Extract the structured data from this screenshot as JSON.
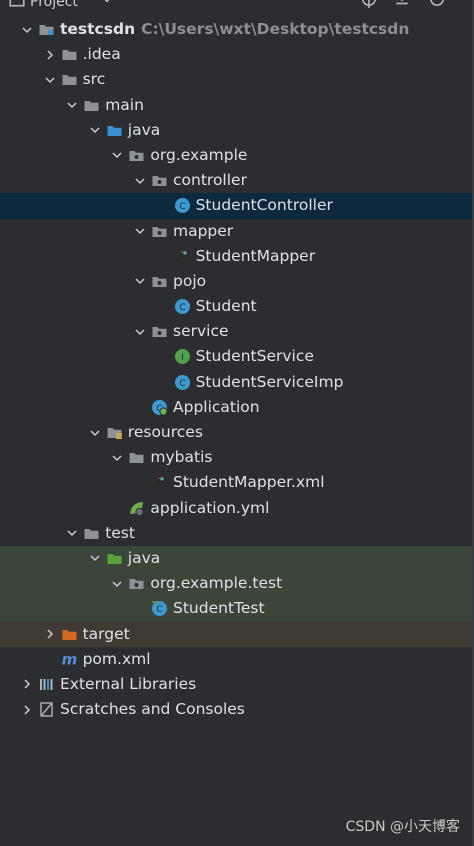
{
  "header": {
    "title": "Project"
  },
  "tree": [
    {
      "depth": 0,
      "arrow": "down",
      "icon": "module-folder",
      "label": "testcsdn",
      "bold": true,
      "path": "C:\\Users\\wxt\\Desktop\\testcsdn"
    },
    {
      "depth": 1,
      "arrow": "right",
      "icon": "folder",
      "label": ".idea"
    },
    {
      "depth": 1,
      "arrow": "down",
      "icon": "folder",
      "label": "src"
    },
    {
      "depth": 2,
      "arrow": "down",
      "icon": "folder",
      "label": "main"
    },
    {
      "depth": 3,
      "arrow": "down",
      "icon": "source-folder",
      "label": "java"
    },
    {
      "depth": 4,
      "arrow": "down",
      "icon": "package",
      "label": "org.example"
    },
    {
      "depth": 5,
      "arrow": "down",
      "icon": "package",
      "label": "controller"
    },
    {
      "depth": 6,
      "arrow": "",
      "icon": "class",
      "label": "StudentController",
      "selected": true
    },
    {
      "depth": 5,
      "arrow": "down",
      "icon": "package",
      "label": "mapper"
    },
    {
      "depth": 6,
      "arrow": "",
      "icon": "mybatis",
      "label": "StudentMapper"
    },
    {
      "depth": 5,
      "arrow": "down",
      "icon": "package",
      "label": "pojo"
    },
    {
      "depth": 6,
      "arrow": "",
      "icon": "class",
      "label": "Student"
    },
    {
      "depth": 5,
      "arrow": "down",
      "icon": "package",
      "label": "service"
    },
    {
      "depth": 6,
      "arrow": "",
      "icon": "interface",
      "label": "StudentService"
    },
    {
      "depth": 6,
      "arrow": "",
      "icon": "class",
      "label": "StudentServiceImp"
    },
    {
      "depth": 5,
      "arrow": "",
      "icon": "spring-class",
      "label": "Application"
    },
    {
      "depth": 3,
      "arrow": "down",
      "icon": "resources-folder",
      "label": "resources"
    },
    {
      "depth": 4,
      "arrow": "down",
      "icon": "folder",
      "label": "mybatis"
    },
    {
      "depth": 5,
      "arrow": "",
      "icon": "mybatis",
      "label": "StudentMapper.xml"
    },
    {
      "depth": 4,
      "arrow": "",
      "icon": "spring-yml",
      "label": "application.yml"
    },
    {
      "depth": 2,
      "arrow": "down",
      "icon": "folder",
      "label": "test"
    },
    {
      "depth": 3,
      "arrow": "down",
      "icon": "test-folder",
      "label": "java",
      "bg": "test"
    },
    {
      "depth": 4,
      "arrow": "down",
      "icon": "package",
      "label": "org.example.test",
      "bg": "test"
    },
    {
      "depth": 5,
      "arrow": "",
      "icon": "test-class",
      "label": "StudentTest",
      "bg": "test"
    },
    {
      "depth": 1,
      "arrow": "right",
      "icon": "excluded-folder",
      "label": "target",
      "bg": "excluded"
    },
    {
      "depth": 1,
      "arrow": "",
      "icon": "maven",
      "label": "pom.xml"
    },
    {
      "depth": 0,
      "arrow": "right",
      "icon": "libraries",
      "label": "External Libraries"
    },
    {
      "depth": 0,
      "arrow": "right",
      "icon": "scratches",
      "label": "Scratches and Consoles"
    }
  ],
  "watermark": "CSDN @小天博客",
  "colors": {
    "selected": "#0d293e",
    "test_bg": "#3c4539",
    "excluded_bg": "#403a35",
    "class_icon": "#3d9ad1",
    "interface_icon": "#4fa14b",
    "folder": "#8e9297",
    "source_folder": "#3d8fd1",
    "test_folder": "#5aa33b",
    "excluded_folder": "#d2691e"
  }
}
